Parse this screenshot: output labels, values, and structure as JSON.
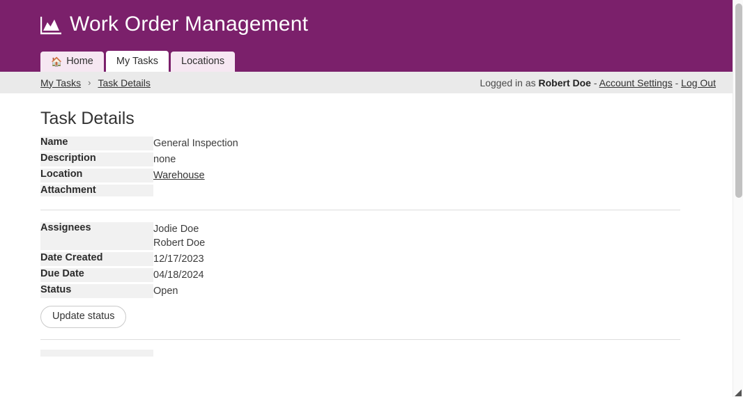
{
  "header": {
    "brand_icon": "chart-area-icon",
    "title": "Work Order Management",
    "background_color": "#7B206B",
    "tabs": [
      {
        "label": "Home",
        "icon": "home-icon",
        "active": false
      },
      {
        "label": "My Tasks",
        "icon": "",
        "active": true
      },
      {
        "label": "Locations",
        "icon": "",
        "active": false
      }
    ]
  },
  "subbar": {
    "breadcrumb": [
      {
        "label": "My Tasks"
      },
      {
        "label": "Task Details"
      }
    ],
    "separator": "›",
    "account": {
      "prefix": "Logged in as",
      "user": "Robert Doe",
      "dash1": "-",
      "settings_label": "Account Settings",
      "dash2": "-",
      "logout_label": "Log Out"
    }
  },
  "main": {
    "page_title": "Task Details",
    "details_table": [
      {
        "label": "Name",
        "value": "General Inspection",
        "is_link": false
      },
      {
        "label": "Description",
        "value": "none",
        "is_link": false
      },
      {
        "label": "Location",
        "value": "Warehouse",
        "is_link": true
      },
      {
        "label": "Attachment",
        "value": "",
        "is_link": false
      }
    ],
    "meta_table": {
      "assignees_label": "Assignees",
      "assignees": [
        "Jodie Doe",
        "Robert Doe"
      ],
      "date_created_label": "Date Created",
      "date_created": "12/17/2023",
      "due_date_label": "Due Date",
      "due_date": "04/18/2024",
      "status_label": "Status",
      "status": "Open"
    },
    "update_status_button": "Update status"
  },
  "scrollbar": {
    "thumb_color": "#C1C1C1",
    "track_color": "#FAFAFA"
  }
}
